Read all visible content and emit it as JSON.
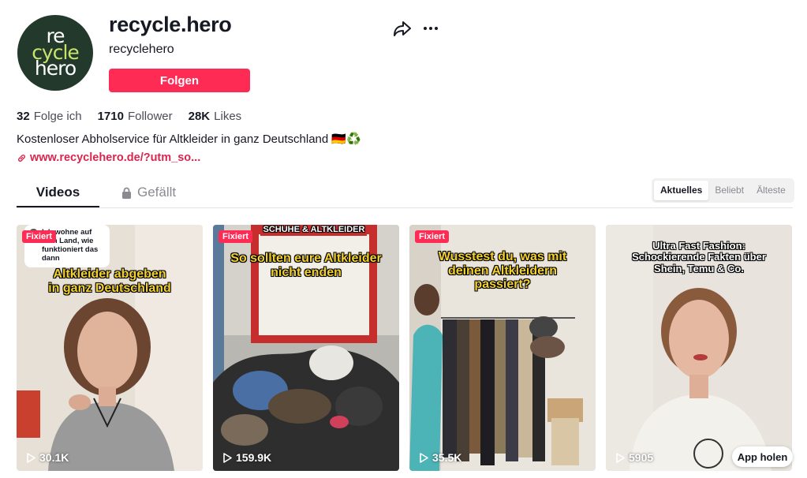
{
  "profile": {
    "avatar_text": [
      "re",
      "cycle",
      "hero"
    ],
    "username": "recycle.hero",
    "nickname": "recyclehero",
    "follow_label": "Folgen",
    "share_icon": "share-arrow-icon",
    "more_icon": "more-dots-icon"
  },
  "stats": [
    {
      "value": "32",
      "label": "Folge ich"
    },
    {
      "value": "1710",
      "label": "Follower"
    },
    {
      "value": "28K",
      "label": "Likes"
    }
  ],
  "bio": "Kostenloser Abholservice für Altkleider in ganz Deutschland 🇩🇪♻️",
  "link": "www.recyclehero.de/?utm_so...",
  "tabs": {
    "videos": "Videos",
    "liked": "Gefällt"
  },
  "sort": [
    "Aktuelles",
    "Beliebt",
    "Älteste"
  ],
  "videos": [
    {
      "pinned": "Fixiert",
      "speech": "Ich wohne auf dem Land, wie funktioniert das dann",
      "caption_line1": "Altkleider abgeben",
      "caption_line2": "in ganz Deutschland",
      "views": "30.1K"
    },
    {
      "pinned": "Fixiert",
      "caption_line1": "So sollten eure Altkleider",
      "caption_line2": "nicht enden",
      "views": "159.9K",
      "sign_text": "SCHUHE & ALTKLEIDER"
    },
    {
      "pinned": "Fixiert",
      "caption_line1": "Wusstest du, was mit",
      "caption_line2": "deinen Altkleidern",
      "caption_line3": "passiert?",
      "views": "35.5K"
    },
    {
      "caption_line1": "Ultra Fast Fashion:",
      "caption_line2": "Schockierende Fakten über",
      "caption_line3": "Shein, Temu & Co.",
      "views": "5905"
    }
  ],
  "app_button": "App holen",
  "colors": {
    "accent": "#fe2c55",
    "avatar_bg": "#22392c",
    "avatar_mid": "#c7e36b",
    "caption_yellow": "#f4d22e"
  }
}
